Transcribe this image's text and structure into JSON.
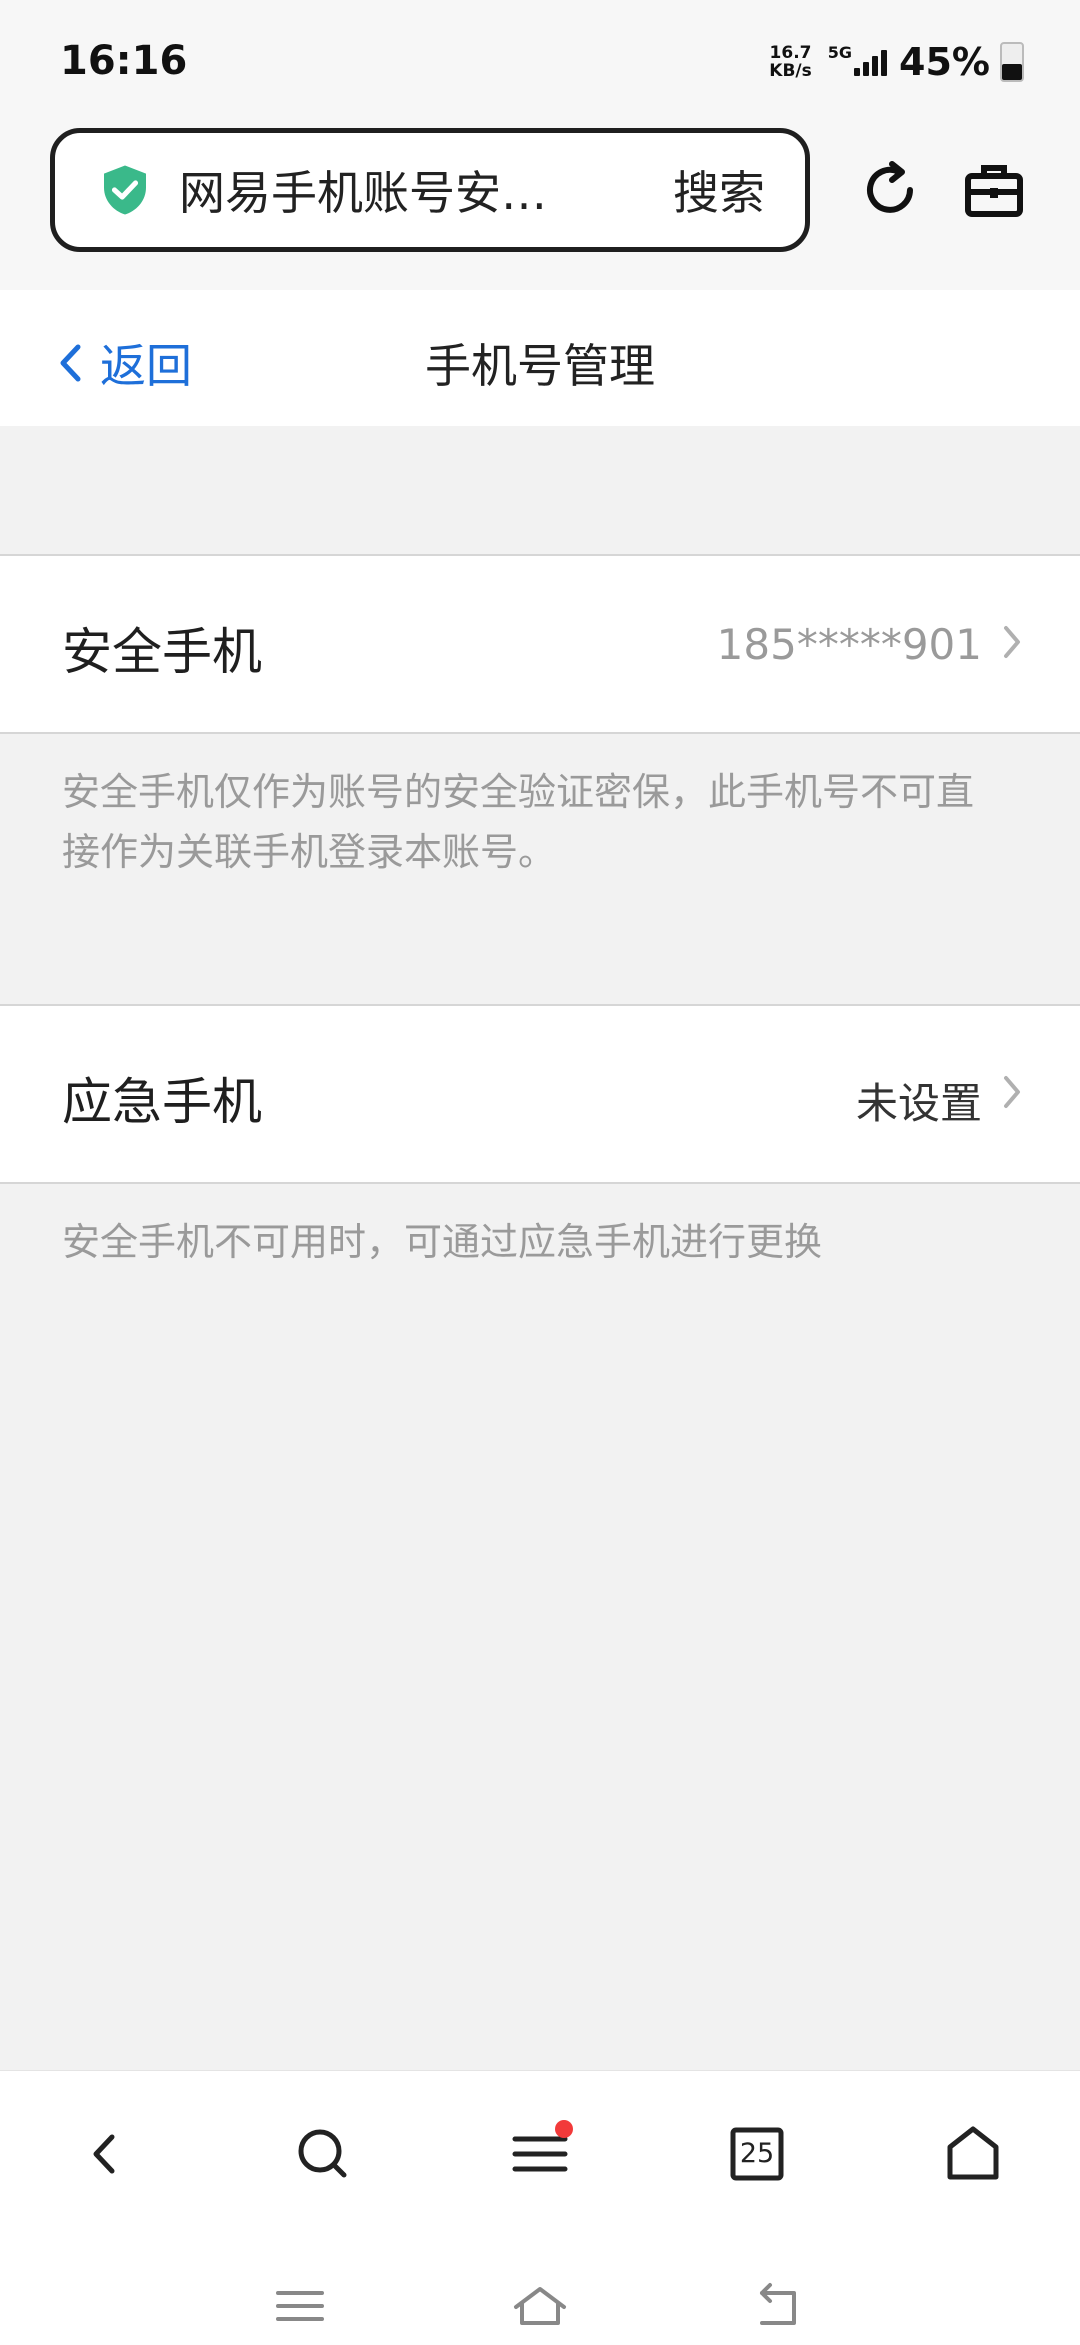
{
  "status_bar": {
    "time": "16:16",
    "net_speed_value": "16.7",
    "net_speed_unit": "KB/s",
    "network": "5G",
    "battery": "45%"
  },
  "browser": {
    "url_text": "网易手机账号安…",
    "search_label": "搜索",
    "shield_color": "#3ab98a"
  },
  "header": {
    "back_label": "返回",
    "title": "手机号管理"
  },
  "rows": [
    {
      "label": "安全手机",
      "value": "185*****901",
      "note": "安全手机仅作为账号的安全验证密保，此手机号不可直接作为关联手机登录本账号。"
    },
    {
      "label": "应急手机",
      "value": "未设置",
      "note": "安全手机不可用时，可通过应急手机进行更换"
    }
  ],
  "bottom_nav": {
    "tabs_count": "25",
    "menu_badge_color": "#f23a3a"
  }
}
